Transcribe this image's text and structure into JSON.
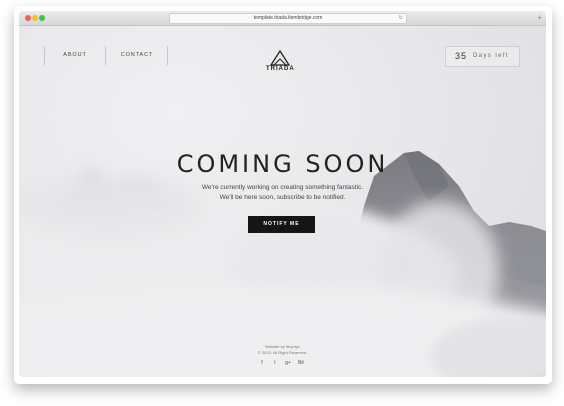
{
  "browser": {
    "url": "template.triada.itembridge.com"
  },
  "nav": {
    "about_label": "ABOUT",
    "contact_label": "CONTACT"
  },
  "logo": {
    "name": "TRIADA",
    "icon": "triangle-mountain-icon"
  },
  "countdown": {
    "number": "35",
    "label": "Days left"
  },
  "hero": {
    "title": "COMING SOON",
    "subtitle_line1": "We're currently working on creating something fantastic.",
    "subtitle_line2": "We'll be here soon, subscribe to be notified.",
    "button_label": "NOTIFY ME"
  },
  "footer": {
    "line1": "Website by Ithyntyn",
    "line2": "© 2015. All Right Reserved.",
    "social": [
      {
        "icon": "facebook-icon",
        "glyph": "f"
      },
      {
        "icon": "twitter-icon",
        "glyph": "t"
      },
      {
        "icon": "googleplus-icon",
        "glyph": "g+"
      },
      {
        "icon": "behance-icon",
        "glyph": "Bē"
      }
    ]
  },
  "colors": {
    "button_bg": "#151515",
    "button_text": "#ffffff",
    "headline": "#222222",
    "background": "#e6e6e8"
  }
}
